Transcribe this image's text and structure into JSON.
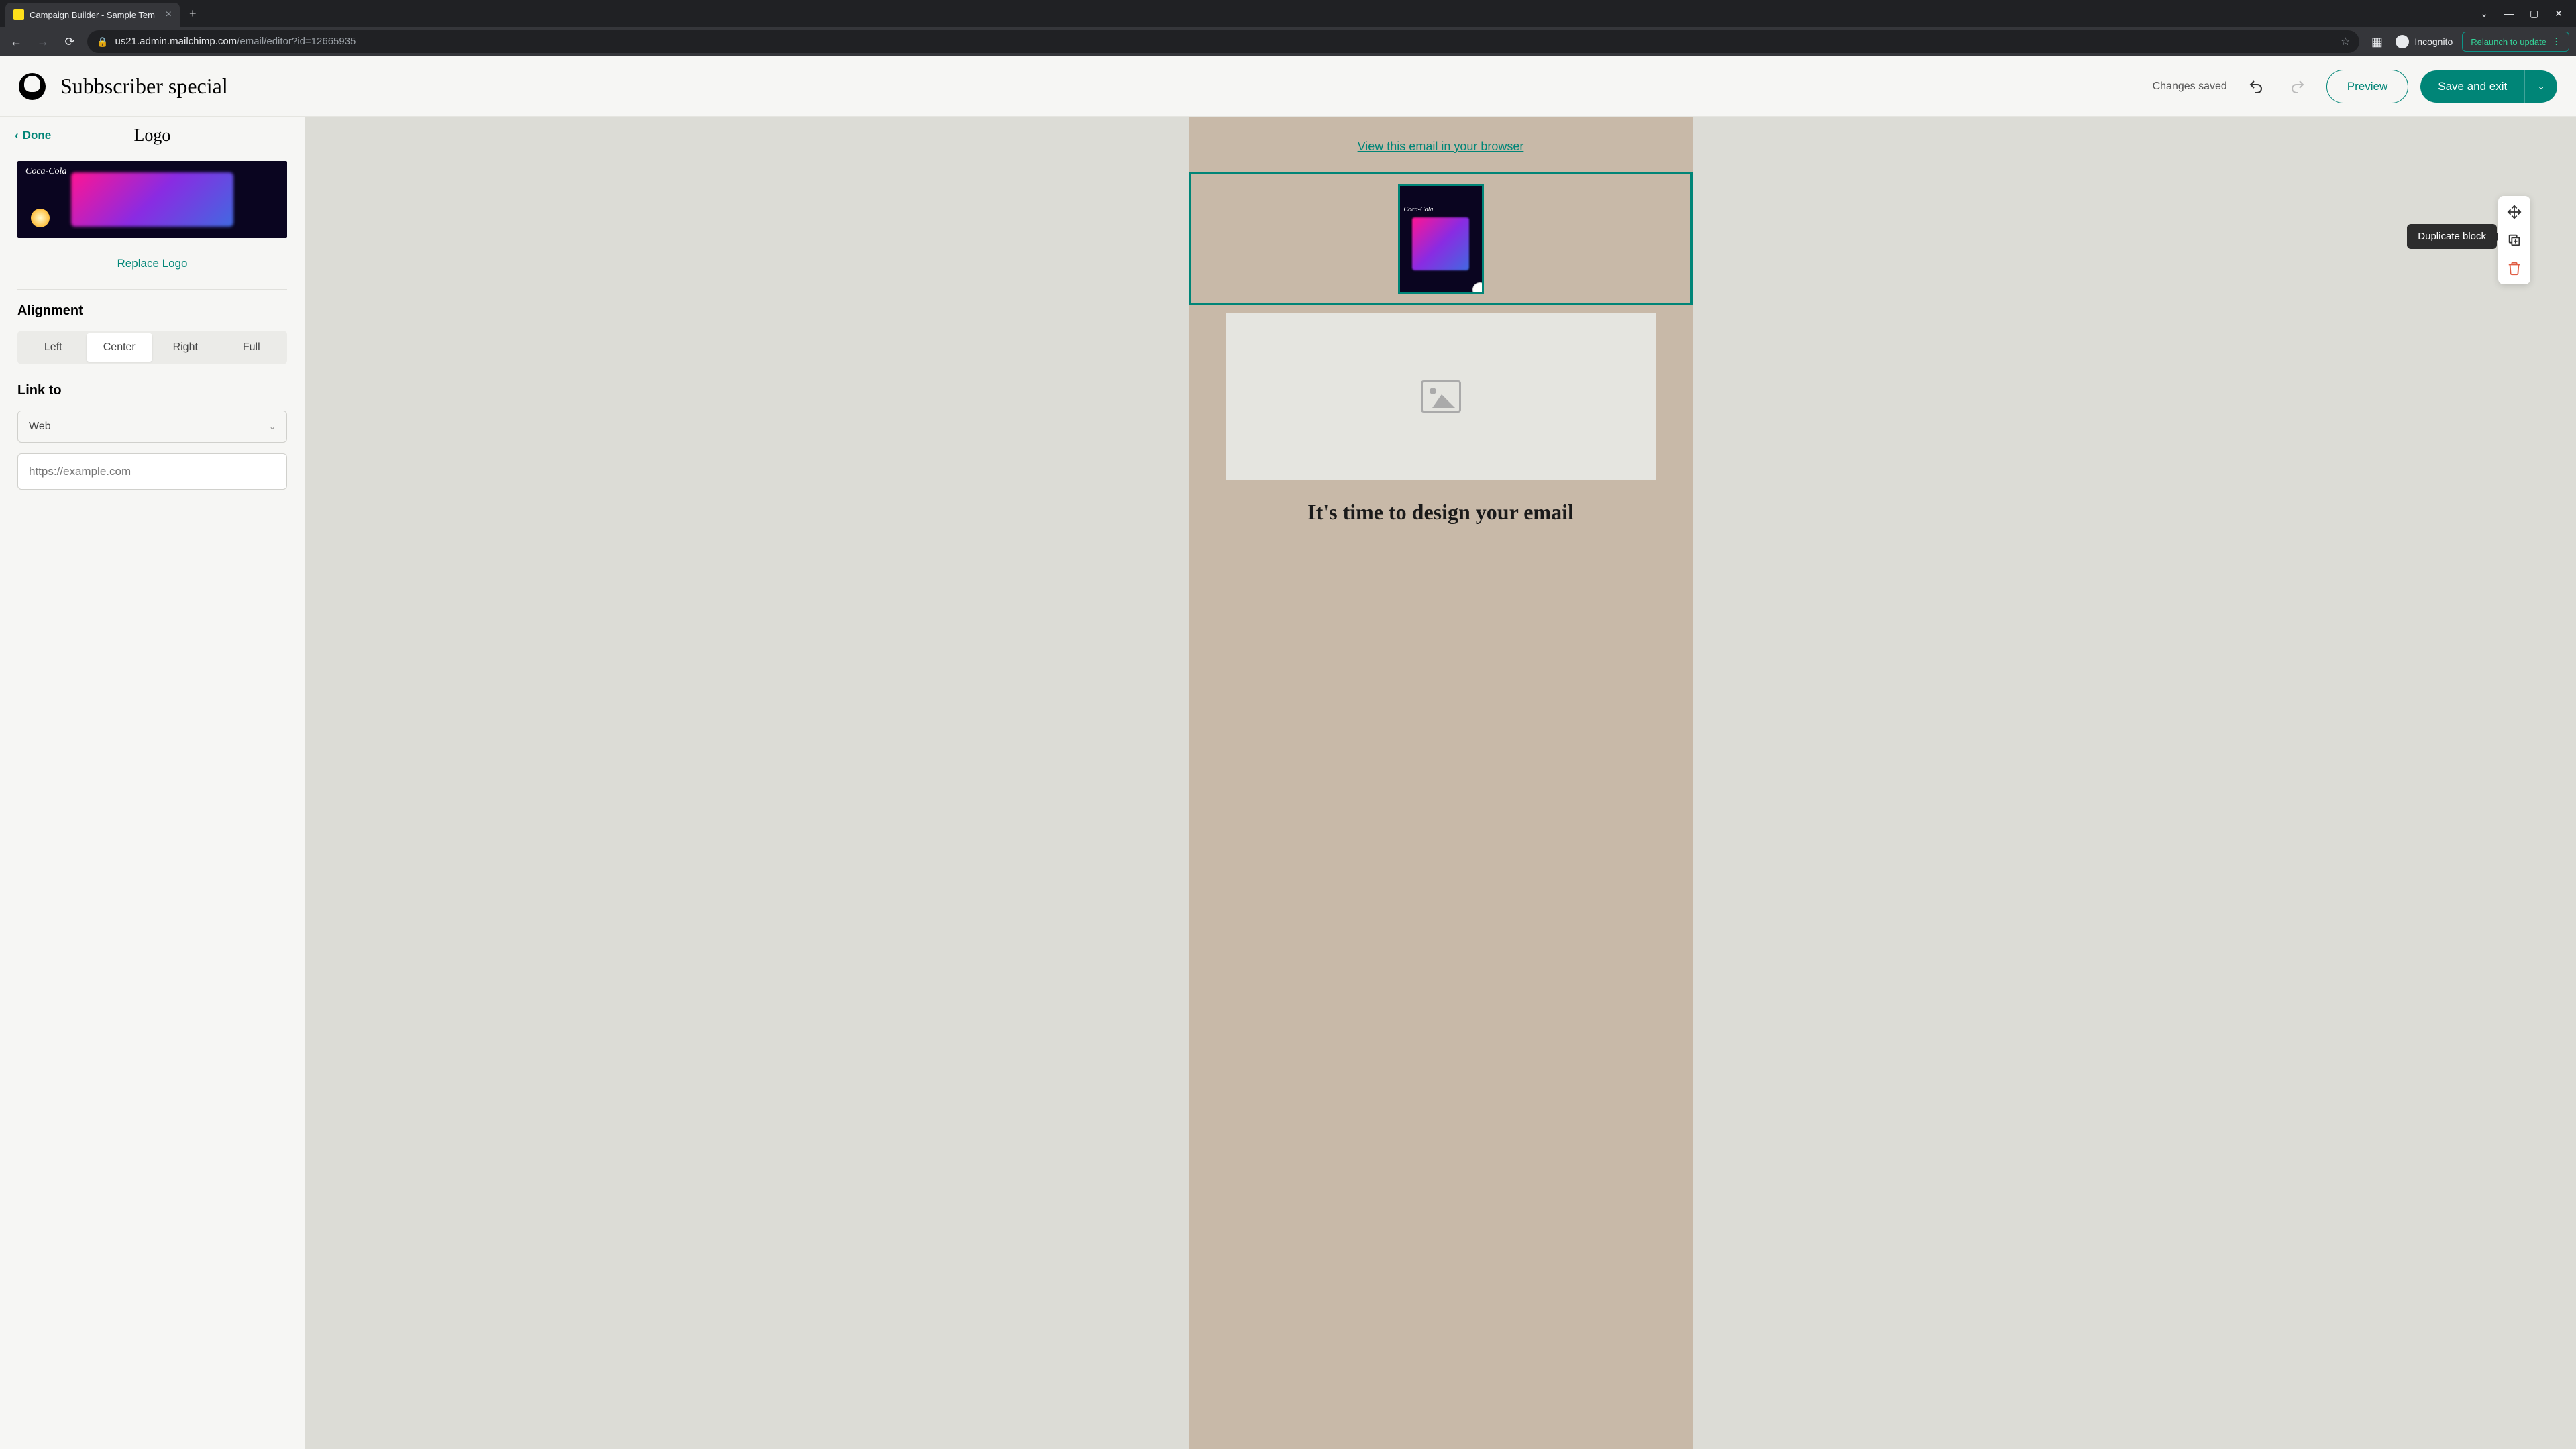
{
  "browser": {
    "tab_title": "Campaign Builder - Sample Tem",
    "url_host": "us21.admin.mailchimp.com",
    "url_path": "/email/editor?id=12665935",
    "incognito_label": "Incognito",
    "relaunch_label": "Relaunch to update"
  },
  "header": {
    "campaign_name": "Subbscriber special",
    "status": "Changes saved",
    "preview_label": "Preview",
    "save_label": "Save and exit"
  },
  "sidebar": {
    "done_label": "Done",
    "title": "Logo",
    "logo_brand_text": "Coca-Cola",
    "replace_label": "Replace Logo",
    "alignment": {
      "label": "Alignment",
      "options": [
        "Left",
        "Center",
        "Right",
        "Full"
      ],
      "selected": "Center"
    },
    "link_to": {
      "label": "Link to",
      "select_value": "Web",
      "url_placeholder": "https://example.com"
    }
  },
  "canvas": {
    "view_in_browser": "View this email in your browser",
    "hero_heading": "It's time to design your email"
  },
  "toolbar": {
    "tooltip": "Duplicate block"
  }
}
